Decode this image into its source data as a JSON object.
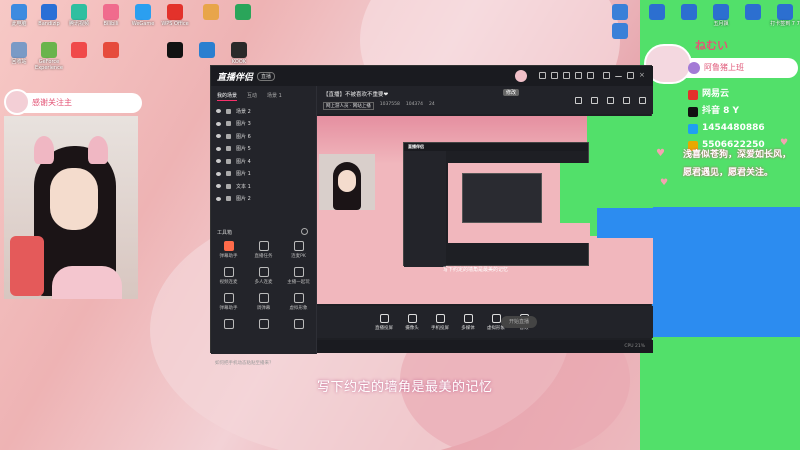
{
  "desktop_icons": [
    {
      "label": "此电脑",
      "color": "#3d8be0"
    },
    {
      "label": "Bandizip",
      "color": "#2a6fd6"
    },
    {
      "label": "腾讯视频",
      "color": "#2fbfa0"
    },
    {
      "label": "Bilibili",
      "color": "#f06b8d"
    },
    {
      "label": "WeGame",
      "color": "#2b9ff0"
    },
    {
      "label": "WPS Office",
      "color": "#e3322b"
    },
    {
      "label": "",
      "color": "#e8a54a"
    },
    {
      "label": "",
      "color": "#2aa55a"
    },
    {
      "label": "回收站",
      "color": "#7a9ac6"
    },
    {
      "label": "GeForce Experience",
      "color": "#6ab44c"
    },
    {
      "label": "",
      "color": "#f04a4a"
    },
    {
      "label": "",
      "color": "#e64b3c"
    },
    {
      "label": "",
      "color": "#111"
    },
    {
      "label": "",
      "color": "#2a7fd0"
    },
    {
      "label": "KOOK",
      "color": "#2a2a2a"
    }
  ],
  "right_icons": [
    {
      "label": "",
      "color": "#3a80d8"
    },
    {
      "label": "",
      "color": "#3a80d8"
    }
  ],
  "green_icons": [
    {
      "label": "",
      "color": "#2c6fd0"
    },
    {
      "label": "",
      "color": "#2c6fd0"
    },
    {
      "label": "五月飘",
      "color": "#2c6fd0"
    },
    {
      "label": "",
      "color": "#2c6fd0"
    },
    {
      "label": "打卡签到 7 7",
      "color": "#2c6fd0"
    }
  ],
  "webcam_bubble": {
    "text": "感谢关注主"
  },
  "streamer": {
    "nemu": "ねむい",
    "name": "阿鲁猪上班",
    "socials": [
      {
        "text": "网易云",
        "color": "#e3322b"
      },
      {
        "text": "抖音 8 Y",
        "color": "#111"
      },
      {
        "text": "1454480886",
        "color": "#1fa0f0"
      },
      {
        "text": "5506622250",
        "color": "#e8a800"
      }
    ],
    "slogan": "浅喜似苍狗，深爱如长风，愿君遇见，愿君关注。"
  },
  "window": {
    "app_name": "直播伴侣",
    "badge": "直播",
    "side_tabs": [
      "我的场景",
      "互动",
      "场景 1"
    ],
    "scenes": [
      {
        "label": "场景 2",
        "locked": false
      },
      {
        "label": "图片 3",
        "locked": false
      },
      {
        "label": "图片 6",
        "locked": false
      },
      {
        "label": "图片 5",
        "locked": false
      },
      {
        "label": "图片 4",
        "locked": false
      },
      {
        "label": "图片 1",
        "locked": false
      },
      {
        "label": "文本 1",
        "locked": true
      },
      {
        "label": "图片 2",
        "locked": false
      }
    ],
    "tools_title": "工具箱",
    "tools": [
      {
        "label": "弹幕助手",
        "hot": true
      },
      {
        "label": "直播任务",
        "hot": false
      },
      {
        "label": "连麦PK",
        "hot": false
      },
      {
        "label": "视频连麦",
        "hot": false
      },
      {
        "label": "多人连麦",
        "hot": false
      },
      {
        "label": "主播一起玩",
        "hot": false
      },
      {
        "label": "弹幕助手",
        "hot": false
      },
      {
        "label": "调弹幕",
        "hot": false
      },
      {
        "label": "虚拟形象",
        "hot": false
      },
      {
        "label": "",
        "hot": false
      },
      {
        "label": "",
        "hot": false
      },
      {
        "label": "",
        "hot": false
      }
    ],
    "tip": "如何把手机动态粘贴至播来？",
    "title": "【直播】不被喜欢不重要❤",
    "title_badge": "修改",
    "info": [
      "网上游人员 · 网站上播",
      "1037558",
      "104374",
      "24"
    ],
    "preview_text": "写下约定的墙角是最美的记忆",
    "controls": [
      "直播投屏",
      "摄像头",
      "手机投屏",
      "多媒体",
      "虚拟形象",
      "音效"
    ],
    "start_label": "开始直播",
    "status": [
      "",
      "",
      "",
      "CPU 21%"
    ]
  },
  "lyric": "写下约定的墙角是最美的记忆"
}
